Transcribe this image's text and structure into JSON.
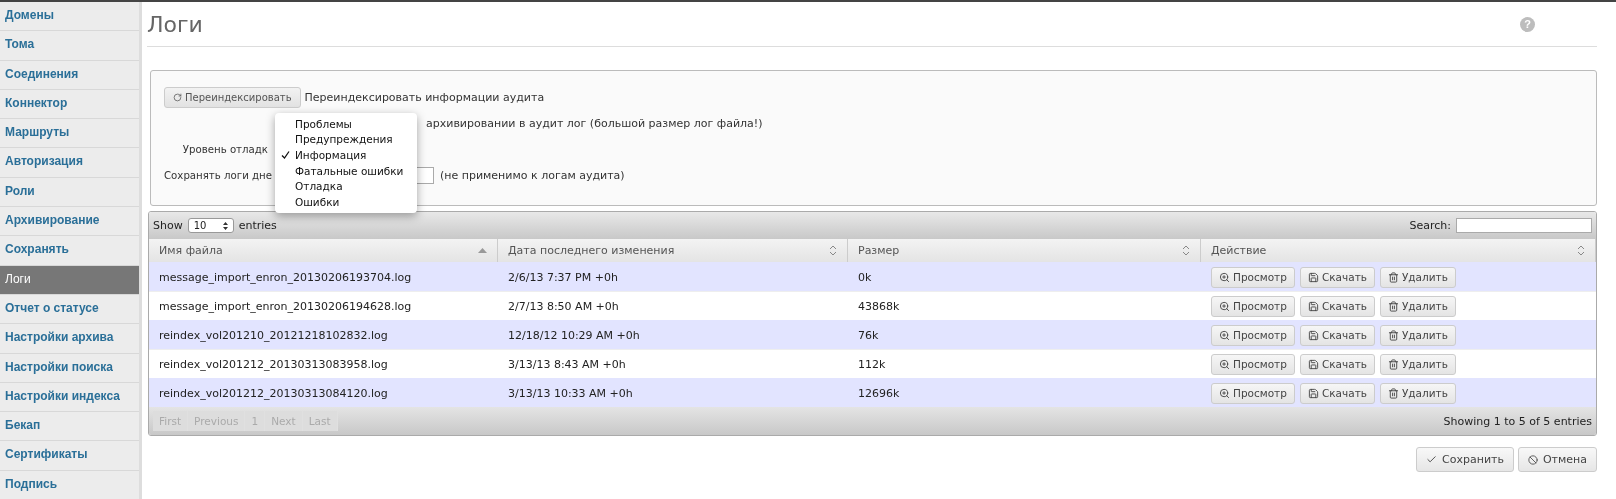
{
  "sidebar": {
    "items": [
      {
        "label": "Домены",
        "selected": false
      },
      {
        "label": "Тома",
        "selected": false
      },
      {
        "label": "Соединения",
        "selected": false
      },
      {
        "label": "Коннектор",
        "selected": false
      },
      {
        "label": "Маршруты",
        "selected": false
      },
      {
        "label": "Авторизация",
        "selected": false
      },
      {
        "label": "Роли",
        "selected": false
      },
      {
        "label": "Архивирование",
        "selected": false
      },
      {
        "label": "Сохранять",
        "selected": false
      },
      {
        "label": "Логи",
        "selected": true
      },
      {
        "label": "Отчет о статусе",
        "selected": false
      },
      {
        "label": "Настройки архива",
        "selected": false
      },
      {
        "label": "Настройки поиска",
        "selected": false
      },
      {
        "label": "Настройки индекса",
        "selected": false
      },
      {
        "label": "Бекап",
        "selected": false
      },
      {
        "label": "Сертификаты",
        "selected": false
      },
      {
        "label": "Подпись",
        "selected": false
      }
    ]
  },
  "page": {
    "title": "Логи",
    "help": "?"
  },
  "settings": {
    "reindex_button": "Переиндексировать",
    "reindex_text": "Переиндексировать информации аудита",
    "audit_text": "архивировании в аудит лог (большой размер лог файла!)",
    "debug_label": "Уровень отладк",
    "keep_label": "Сохранять логи дне",
    "keep_note": "(не применимо к логам аудита)",
    "dropdown": [
      {
        "label": "Проблемы",
        "selected": false
      },
      {
        "label": "Предупреждения",
        "selected": false
      },
      {
        "label": "Информация",
        "selected": true
      },
      {
        "label": "Фатальные ошибки",
        "selected": false
      },
      {
        "label": "Отладка",
        "selected": false
      },
      {
        "label": "Ошибки",
        "selected": false
      }
    ]
  },
  "table": {
    "show_label": "Show",
    "page_size": "10",
    "entries_label": "entries",
    "search_label": "Search:",
    "columns": [
      {
        "label": "Имя файла",
        "sorted": true
      },
      {
        "label": "Дата последнего изменения",
        "sorted": false
      },
      {
        "label": "Размер",
        "sorted": false
      },
      {
        "label": "Действие",
        "sorted": false
      }
    ],
    "rows": [
      {
        "file": "message_import_enron_20130206193704.log",
        "date": "2/6/13 7:37 PM +0h",
        "size": "0k",
        "actions": [
          "Просмотр",
          "Скачать",
          "Удалить"
        ]
      },
      {
        "file": "message_import_enron_20130206194628.log",
        "date": "2/7/13 8:50 AM +0h",
        "size": "43868k",
        "actions": [
          "Просмотр",
          "Скачать",
          "Удалить"
        ]
      },
      {
        "file": "reindex_vol201210_20121218102832.log",
        "date": "12/18/12 10:29 AM +0h",
        "size": "76k",
        "actions": [
          "Просмотр",
          "Скачать",
          "Удалить"
        ]
      },
      {
        "file": "reindex_vol201212_20130313083958.log",
        "date": "3/13/13 8:43 AM +0h",
        "size": "112k",
        "actions": [
          "Просмотр",
          "Скачать",
          "Удалить"
        ]
      },
      {
        "file": "reindex_vol201212_20130313084120.log",
        "date": "3/13/13 10:33 AM +0h",
        "size": "12696k",
        "actions": [
          "Просмотр",
          "Скачать",
          "Удалить"
        ]
      }
    ],
    "pagination": [
      {
        "label": "First",
        "disabled": true
      },
      {
        "label": "Previous",
        "disabled": true
      },
      {
        "label": "1",
        "disabled": true
      },
      {
        "label": "Next",
        "disabled": true
      },
      {
        "label": "Last",
        "disabled": true
      }
    ],
    "info": "Showing 1 to 5 of 5 entries"
  },
  "buttons": [
    {
      "label": "Сохранить",
      "kind": "save"
    },
    {
      "label": "Отмена",
      "kind": "cancel"
    }
  ]
}
